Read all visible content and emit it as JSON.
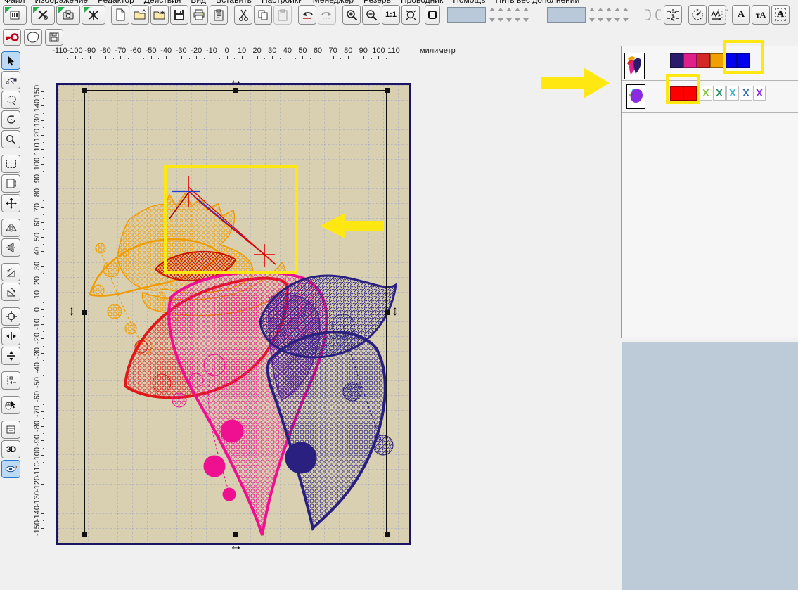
{
  "menu": {
    "items": [
      "Файл",
      "Изображение",
      "Редактор",
      "Действия",
      "Вид",
      "Вставить",
      "Настройки",
      "Менеджер",
      "Резерв",
      "Проводник",
      "Помощь",
      "Нить вес дополнении"
    ]
  },
  "toolbar": {
    "ratio_label": "1:1",
    "letter_a": "A",
    "letter_ta": "тA",
    "letter_mono": "A"
  },
  "left_toolbar": {
    "label_3d": "3D"
  },
  "rulers": {
    "unit_label": "милиметр",
    "horizontal": {
      "min": -110,
      "max": 110,
      "step": 10
    },
    "vertical": {
      "min": -150,
      "max": 150,
      "step": 10
    }
  },
  "right_panel": {
    "design1": {
      "palette": [
        "#2b1b6b",
        "#e01f8a",
        "#d42727",
        "#f0a000",
        "#0000ee",
        "#0000ee"
      ]
    },
    "design2": {
      "palette": [
        "#ff0000",
        "#ff0000"
      ],
      "x_marks": [
        {
          "label": "X",
          "color": "#8cc63e"
        },
        {
          "label": "X",
          "color": "#2f8f72"
        },
        {
          "label": "X",
          "color": "#3fb0c8"
        },
        {
          "label": "X",
          "color": "#2f73b8"
        },
        {
          "label": "X",
          "color": "#8a2be2"
        }
      ]
    }
  },
  "design": {
    "colors": {
      "orange": "#f09c00",
      "red": "#e01818",
      "dark_red": "#cc1500",
      "magenta": "#ee1090",
      "purple": "#6a1fa0",
      "navy": "#2a2080",
      "stitch_red": "#e00000",
      "stitch_blue": "#2040d0",
      "stitch_dark": "#8a0020"
    },
    "canvas_background": "#d9d0b2",
    "grid_color": "#9aa0c8",
    "frame_color": "#1b1464"
  },
  "annotations": {
    "highlight_color": "#ffe712"
  }
}
